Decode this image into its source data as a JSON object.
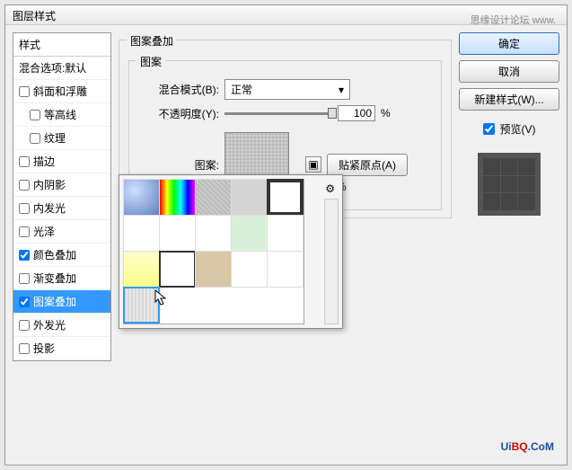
{
  "dialog_title": "图层样式",
  "left": {
    "header": "样式",
    "blend_label": "混合选项:默认",
    "items": [
      {
        "label": "斜面和浮雕",
        "checked": false
      },
      {
        "label": "等高线",
        "checked": false,
        "sub": true
      },
      {
        "label": "纹理",
        "checked": false,
        "sub": true
      },
      {
        "label": "描边",
        "checked": false
      },
      {
        "label": "内阴影",
        "checked": false
      },
      {
        "label": "内发光",
        "checked": false
      },
      {
        "label": "光泽",
        "checked": false
      },
      {
        "label": "颜色叠加",
        "checked": true
      },
      {
        "label": "渐变叠加",
        "checked": false
      },
      {
        "label": "图案叠加",
        "checked": true,
        "selected": true
      },
      {
        "label": "外发光",
        "checked": false
      },
      {
        "label": "投影",
        "checked": false
      }
    ]
  },
  "mid": {
    "outer_title": "图案叠加",
    "inner_title": "图案",
    "blend_mode_label": "混合模式(B):",
    "blend_mode_value": "正常",
    "opacity_label": "不透明度(Y):",
    "opacity_value": "100",
    "opacity_unit": "%",
    "pattern_label": "图案:",
    "snap_label": "贴紧原点(A)",
    "stray_percent": "%"
  },
  "right": {
    "ok": "确定",
    "cancel": "取消",
    "new_style": "新建样式(W)...",
    "preview_label": "预览(V)",
    "preview_checked": true
  },
  "picker": {
    "gear_icon": "⚙",
    "cells": [
      {
        "bg": "radial-gradient(circle at 30% 30%, #cfe0ff, #6080c0)"
      },
      {
        "bg": "linear-gradient(90deg,#f00,#ff0,#0f0,#0ff,#00f,#f0f)"
      },
      {
        "bg": "repeating-linear-gradient(45deg,#bbb 0 2px,#ccc 2px 4px)"
      },
      {
        "bg": "#d4d4d4"
      },
      {
        "bg": "#fff",
        "border": "4px solid #333"
      },
      {
        "bg": "#fff"
      },
      {
        "bg": "#fff"
      },
      {
        "bg": "#fff"
      },
      {
        "bg": "linear-gradient(#d8f0d8,#d8f0d8)"
      },
      {
        "bg": "#fff"
      },
      {
        "bg": "linear-gradient(#ffffcc,#ffff88)"
      },
      {
        "bg": "#fff",
        "border": "2px solid #333"
      },
      {
        "bg": "#d8c8a8"
      },
      {
        "bg": "#fff"
      },
      {
        "bg": "#fff"
      },
      {
        "bg": "repeating-linear-gradient(90deg,#d8d8d8 0 2px,#e8e8e8 2px 4px)",
        "selected": true
      }
    ]
  },
  "watermark_top": "思缘设计论坛  www.    ",
  "watermark_bottom": {
    "u": "U",
    "i": "i",
    "bq": "BQ",
    "dot": ".",
    "c": "C",
    "o": "o",
    "m": "M"
  }
}
